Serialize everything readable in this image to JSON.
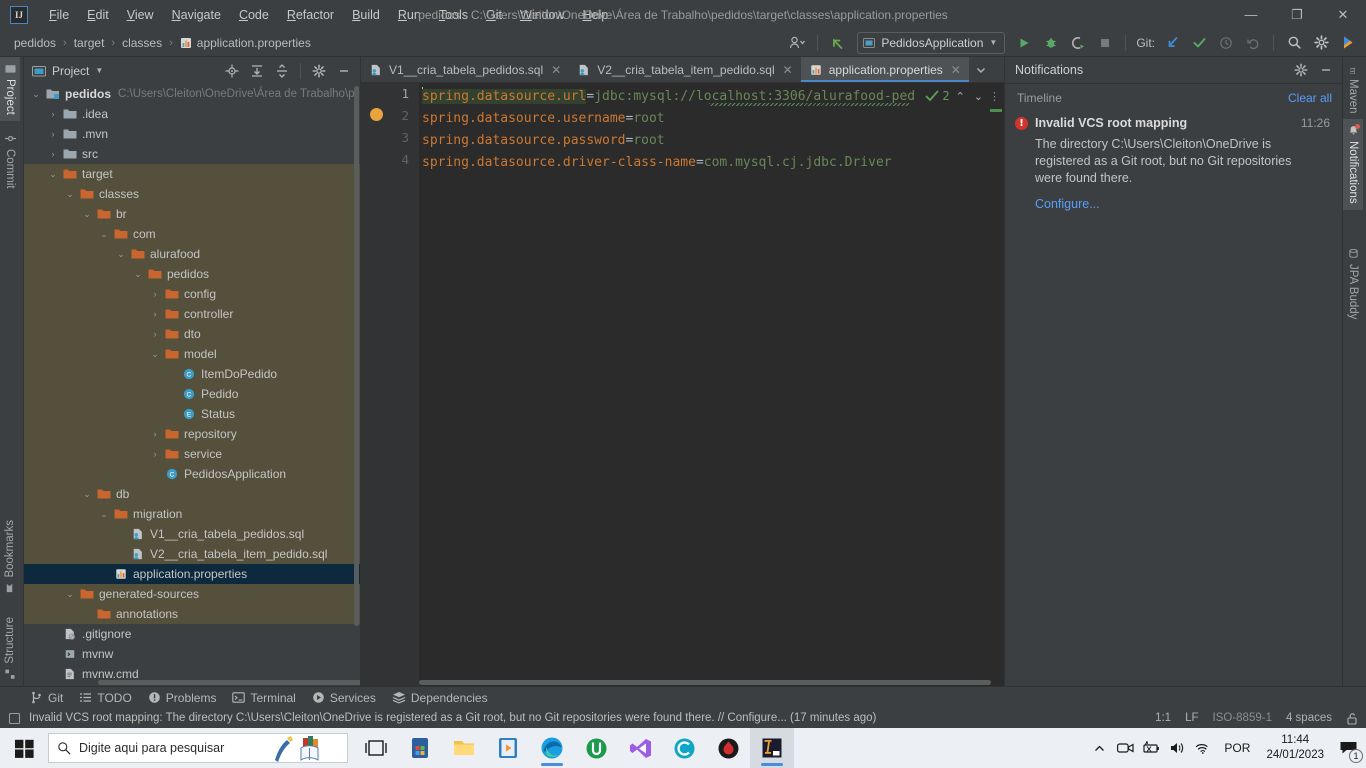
{
  "window": {
    "title": "pedidos - C:\\Users\\Cleiton\\OneDrive\\Área de Trabalho\\pedidos\\target\\classes\\application.properties",
    "logo_text": "IJ",
    "minimize": "—",
    "maximize": "❐",
    "close": "✕"
  },
  "menubar": {
    "items": [
      {
        "label": "File",
        "mnemonic": "F"
      },
      {
        "label": "Edit",
        "mnemonic": "E"
      },
      {
        "label": "View",
        "mnemonic": "V"
      },
      {
        "label": "Navigate",
        "mnemonic": "N"
      },
      {
        "label": "Code",
        "mnemonic": "C"
      },
      {
        "label": "Refactor",
        "mnemonic": "R"
      },
      {
        "label": "Build",
        "mnemonic": "B"
      },
      {
        "label": "Run",
        "mnemonic": "R"
      },
      {
        "label": "Tools",
        "mnemonic": "T"
      },
      {
        "label": "Git",
        "mnemonic": "G"
      },
      {
        "label": "Window",
        "mnemonic": "W"
      },
      {
        "label": "Help",
        "mnemonic": "H"
      }
    ]
  },
  "breadcrumbs": {
    "items": [
      "pedidos",
      "target",
      "classes",
      "application.properties"
    ],
    "separator": "›"
  },
  "toolbar": {
    "run_config": "PedidosApplication",
    "git_label": "Git:",
    "icons": [
      "user-avatar-icon",
      "undo-arrow-icon",
      "run-icon",
      "debug-icon",
      "run-with-coverage-icon",
      "stop-icon",
      "update-project-icon",
      "commit-icon",
      "history-icon",
      "rollback-icon",
      "search-everywhere-icon",
      "settings-icon",
      "ide-assistant-icon"
    ]
  },
  "sidebar_left": {
    "top": [
      {
        "label": "Project",
        "icon": "project-icon",
        "active": true
      },
      {
        "label": "Commit",
        "icon": "commit-icon",
        "active": false
      }
    ],
    "bottom": [
      {
        "label": "Bookmarks",
        "icon": "bookmark-icon",
        "active": false
      },
      {
        "label": "Structure",
        "icon": "structure-icon",
        "active": false
      }
    ]
  },
  "sidebar_right": {
    "items": [
      {
        "label": "Maven",
        "icon": "maven-icon",
        "active": false
      },
      {
        "label": "Notifications",
        "icon": "bell-icon",
        "active": true
      },
      {
        "label": "JPA Buddy",
        "icon": "jpa-buddy-icon",
        "active": false
      }
    ]
  },
  "project_panel": {
    "title": "Project",
    "header_icons": [
      "locate-icon",
      "expand-all-icon",
      "collapse-all-icon",
      "gear-icon",
      "hide-icon"
    ],
    "tree": [
      {
        "depth": 0,
        "label": "pedidos",
        "path": "C:\\Users\\Cleiton\\OneDrive\\Área de Trabalho\\p",
        "icon": "module-folder-icon",
        "arrow": "expanded",
        "bold": true,
        "state": "normal"
      },
      {
        "depth": 1,
        "label": ".idea",
        "icon": "folder-gray-icon",
        "arrow": "collapsed",
        "state": "normal"
      },
      {
        "depth": 1,
        "label": ".mvn",
        "icon": "folder-gray-icon",
        "arrow": "collapsed",
        "state": "normal"
      },
      {
        "depth": 1,
        "label": "src",
        "icon": "folder-gray-icon",
        "arrow": "collapsed",
        "state": "normal"
      },
      {
        "depth": 1,
        "label": "target",
        "icon": "folder-orange-icon",
        "arrow": "expanded",
        "state": "excluded"
      },
      {
        "depth": 2,
        "label": "classes",
        "icon": "folder-orange-icon",
        "arrow": "expanded",
        "state": "excluded"
      },
      {
        "depth": 3,
        "label": "br",
        "icon": "folder-orange-icon",
        "arrow": "expanded",
        "state": "excluded"
      },
      {
        "depth": 4,
        "label": "com",
        "icon": "folder-orange-icon",
        "arrow": "expanded",
        "state": "excluded"
      },
      {
        "depth": 5,
        "label": "alurafood",
        "icon": "folder-orange-icon",
        "arrow": "expanded",
        "state": "excluded"
      },
      {
        "depth": 6,
        "label": "pedidos",
        "icon": "folder-orange-icon",
        "arrow": "expanded",
        "state": "excluded"
      },
      {
        "depth": 7,
        "label": "config",
        "icon": "folder-orange-icon",
        "arrow": "collapsed",
        "state": "excluded"
      },
      {
        "depth": 7,
        "label": "controller",
        "icon": "folder-orange-icon",
        "arrow": "collapsed",
        "state": "excluded"
      },
      {
        "depth": 7,
        "label": "dto",
        "icon": "folder-orange-icon",
        "arrow": "collapsed",
        "state": "excluded"
      },
      {
        "depth": 7,
        "label": "model",
        "icon": "folder-orange-icon",
        "arrow": "expanded",
        "state": "excluded"
      },
      {
        "depth": 8,
        "label": "ItemDoPedido",
        "icon": "class-icon",
        "arrow": "none",
        "state": "excluded"
      },
      {
        "depth": 8,
        "label": "Pedido",
        "icon": "class-icon",
        "arrow": "none",
        "state": "excluded"
      },
      {
        "depth": 8,
        "label": "Status",
        "icon": "enum-icon",
        "arrow": "none",
        "state": "excluded"
      },
      {
        "depth": 7,
        "label": "repository",
        "icon": "folder-orange-icon",
        "arrow": "collapsed",
        "state": "excluded"
      },
      {
        "depth": 7,
        "label": "service",
        "icon": "folder-orange-icon",
        "arrow": "collapsed",
        "state": "excluded"
      },
      {
        "depth": 7,
        "label": "PedidosApplication",
        "icon": "class-icon",
        "arrow": "none",
        "state": "excluded"
      },
      {
        "depth": 3,
        "label": "db",
        "icon": "folder-orange-icon",
        "arrow": "expanded",
        "state": "excluded"
      },
      {
        "depth": 4,
        "label": "migration",
        "icon": "folder-orange-icon",
        "arrow": "expanded",
        "state": "excluded"
      },
      {
        "depth": 5,
        "label": "V1__cria_tabela_pedidos.sql",
        "icon": "sql-file-icon",
        "arrow": "none",
        "state": "excluded"
      },
      {
        "depth": 5,
        "label": "V2__cria_tabela_item_pedido.sql",
        "icon": "sql-file-icon",
        "arrow": "none",
        "state": "excluded"
      },
      {
        "depth": 4,
        "label": "application.properties",
        "icon": "properties-file-icon",
        "arrow": "none",
        "state": "selected"
      },
      {
        "depth": 2,
        "label": "generated-sources",
        "icon": "folder-orange-icon",
        "arrow": "expanded",
        "state": "excluded"
      },
      {
        "depth": 3,
        "label": "annotations",
        "icon": "folder-orange-icon",
        "arrow": "none",
        "state": "excluded"
      },
      {
        "depth": 1,
        "label": ".gitignore",
        "icon": "gitignore-file-icon",
        "arrow": "none",
        "state": "normal"
      },
      {
        "depth": 1,
        "label": "mvnw",
        "icon": "shell-file-icon",
        "arrow": "none",
        "state": "normal"
      },
      {
        "depth": 1,
        "label": "mvnw.cmd",
        "icon": "cmd-file-icon",
        "arrow": "none",
        "state": "normal"
      }
    ]
  },
  "editor": {
    "tabs": [
      {
        "label": "V1__cria_tabela_pedidos.sql",
        "icon": "sql-file-icon",
        "active": false,
        "close": "✕"
      },
      {
        "label": "V2__cria_tabela_item_pedido.sql",
        "icon": "sql-file-icon",
        "active": false,
        "close": "✕"
      },
      {
        "label": "application.properties",
        "icon": "properties-file-icon",
        "active": true,
        "close": "✕"
      }
    ],
    "tabbar_icons": [
      "chevron-down-icon",
      "more-options-icon"
    ],
    "line_numbers": [
      "1",
      "2",
      "3",
      "4"
    ],
    "lines": [
      {
        "key": "spring.datasource.url",
        "eq": "=",
        "value": "jdbc:mysql://localhost:3306/alurafood-ped"
      },
      {
        "key": "spring.datasource.username",
        "eq": "=",
        "value": "root"
      },
      {
        "key": "spring.datasource.password",
        "eq": "=",
        "value": "root"
      },
      {
        "key": "spring.datasource.driver-class-name",
        "eq": "=",
        "value": "com.mysql.cj.jdbc.Driver"
      }
    ],
    "inspection": {
      "count": "2",
      "up": "⌃",
      "down": "⌄"
    }
  },
  "notifications": {
    "title": "Notifications",
    "header_icons": [
      "gear-icon",
      "hide-icon"
    ],
    "timeline_label": "Timeline",
    "clear_all": "Clear all",
    "items": [
      {
        "title": "Invalid VCS root mapping",
        "time": "11:26",
        "body": "The directory C:\\Users\\Cleiton\\OneDrive is registered as a Git root, but no Git repositories were found there.",
        "link": "Configure..."
      }
    ]
  },
  "bottom_tools": {
    "items": [
      {
        "label": "Git",
        "icon": "git-branch-icon"
      },
      {
        "label": "TODO",
        "icon": "todo-list-icon"
      },
      {
        "label": "Problems",
        "icon": "problems-icon"
      },
      {
        "label": "Terminal",
        "icon": "terminal-icon"
      },
      {
        "label": "Services",
        "icon": "services-icon"
      },
      {
        "label": "Dependencies",
        "icon": "dependencies-icon"
      }
    ]
  },
  "statusbar": {
    "message": "Invalid VCS root mapping: The directory C:\\Users\\Cleiton\\OneDrive is registered as a Git root, but no Git repositories were found there. // Configure... (17 minutes ago)",
    "caret_position": "1:1",
    "line_separator": "LF",
    "encoding": "ISO-8859-1",
    "indent": "4 spaces",
    "lock_icon": "unlocked-icon"
  },
  "taskbar": {
    "search_placeholder": "Digite aqui para pesquisar",
    "start_icon": "windows-start-icon",
    "apps": [
      {
        "name": "task-view-icon"
      },
      {
        "name": "microsoft-store-icon"
      },
      {
        "name": "file-explorer-icon"
      },
      {
        "name": "media-player-icon"
      },
      {
        "name": "microsoft-edge-icon"
      },
      {
        "name": "utorrent-icon"
      },
      {
        "name": "visual-studio-icon"
      },
      {
        "name": "copilot-icon"
      },
      {
        "name": "garena-icon"
      },
      {
        "name": "intellij-idea-icon"
      }
    ],
    "tray": {
      "chevron": "⌃",
      "icons": [
        "camera-icon",
        "battery-icon",
        "volume-icon",
        "wifi-icon"
      ],
      "language": "POR",
      "time": "11:44",
      "date": "24/01/2023",
      "notification_count": "1"
    }
  },
  "colors": {
    "accent_blue": "#4a88c7",
    "link_blue": "#589df6",
    "error_red": "#d0342c",
    "excluded_olive": "#54503c",
    "selection_blue": "#0d293e",
    "editor_bg": "#2b2b2b",
    "panel_bg": "#3c3f41",
    "key_orange": "#cc7832",
    "value_green": "#6a8759"
  }
}
